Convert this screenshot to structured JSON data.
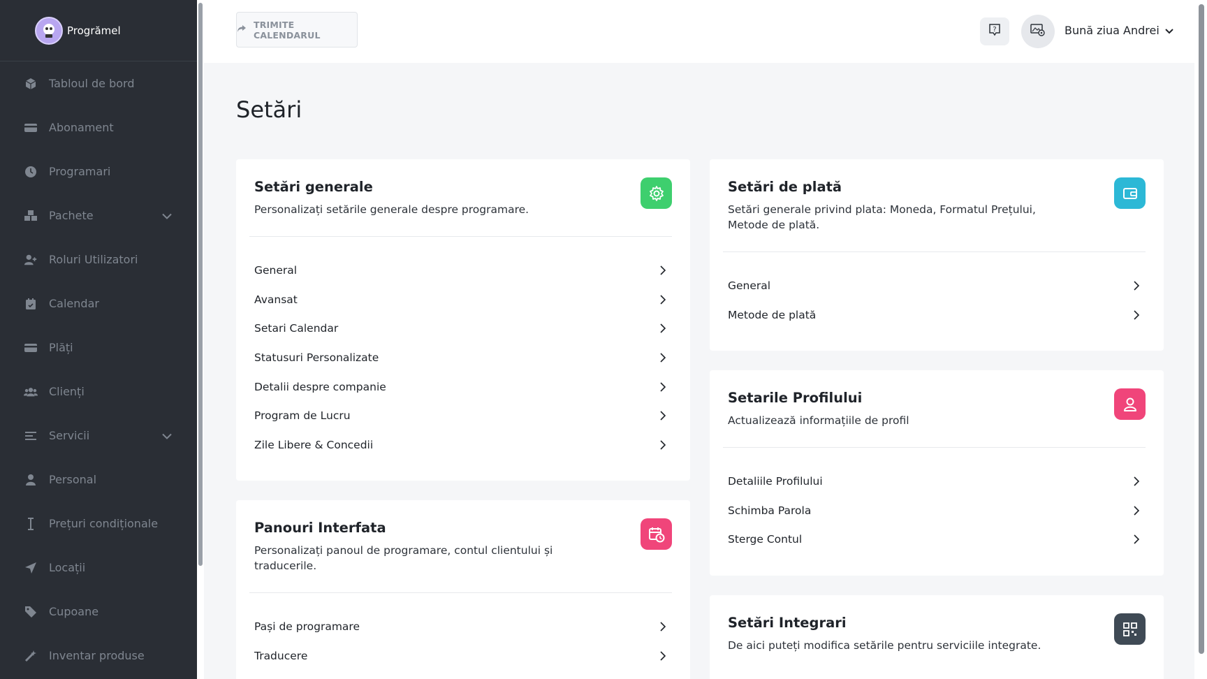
{
  "brand": {
    "name": "Progrămel"
  },
  "sidebar": {
    "items": [
      {
        "label": "Tabloul de bord",
        "icon": "dashboard-icon"
      },
      {
        "label": "Abonament",
        "icon": "card-icon"
      },
      {
        "label": "Programari",
        "icon": "clock-icon"
      },
      {
        "label": "Pachete",
        "icon": "packages-icon",
        "expandable": true
      },
      {
        "label": "Roluri Utilizatori",
        "icon": "user-plus-icon"
      },
      {
        "label": "Calendar",
        "icon": "calendar-icon"
      },
      {
        "label": "Plăți",
        "icon": "card-icon"
      },
      {
        "label": "Clienți",
        "icon": "users-icon"
      },
      {
        "label": "Servicii",
        "icon": "list-icon",
        "expandable": true
      },
      {
        "label": "Personal",
        "icon": "person-icon"
      },
      {
        "label": "Prețuri condiționale",
        "icon": "cursor-icon"
      },
      {
        "label": "Locații",
        "icon": "location-arrow-icon"
      },
      {
        "label": "Cupoane",
        "icon": "tag-icon"
      },
      {
        "label": "Inventar produse",
        "icon": "magic-wand-icon"
      }
    ]
  },
  "header": {
    "share_label": "TRIMITE CALENDARUL",
    "greeting": "Bună ziua Andrei"
  },
  "page": {
    "title": "Setări"
  },
  "cards": {
    "general": {
      "title": "Setări generale",
      "desc": "Personalizați setările generale despre programare.",
      "icon": "gear-icon",
      "color": "#3ecf6e",
      "items": [
        "General",
        "Avansat",
        "Setari Calendar",
        "Statusuri Personalizate",
        "Detalii despre companie",
        "Program de Lucru",
        "Zile Libere & Concedii"
      ]
    },
    "interface": {
      "title": "Panouri Interfata",
      "desc": "Personalizați panoul de programare, contul clientului și traducerile.",
      "icon": "calendar-clock-icon",
      "color": "#f0457a",
      "items": [
        "Pași de programare",
        "Traducere"
      ]
    },
    "payment": {
      "title": "Setări de plată",
      "desc": "Setări generale privind plata: Moneda, Formatul Prețului, Metode de plată.",
      "icon": "wallet-icon",
      "color": "#2cb8d6",
      "items": [
        "General",
        "Metode de plată"
      ]
    },
    "profile": {
      "title": "Setarile Profilului",
      "desc": "Actualizează informațiile de profil",
      "icon": "user-icon",
      "color": "#f0457a",
      "items": [
        "Detaliile Profilului",
        "Schimba Parola",
        "Sterge Contul"
      ]
    },
    "integrations": {
      "title": "Setări Integrari",
      "desc": "De aici puteți modifica setările pentru serviciile integrate.",
      "icon": "qr-icon",
      "color": "#3f4a55"
    }
  }
}
